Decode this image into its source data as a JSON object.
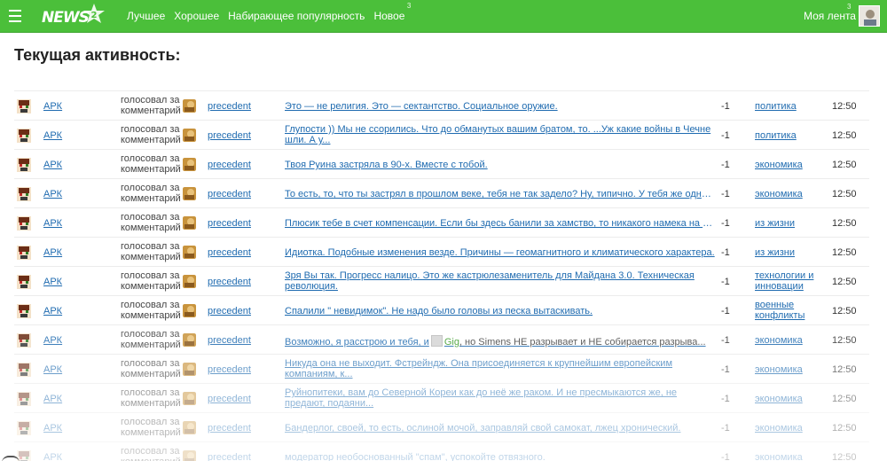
{
  "header": {
    "logo_text": "NEWS",
    "logo_badge": "2",
    "nav": [
      {
        "label": "Лучшее",
        "badge": ""
      },
      {
        "label": "Хорошее",
        "badge": ""
      },
      {
        "label": "Набирающее популярность",
        "badge": ""
      },
      {
        "label": "Новое",
        "badge": "3"
      }
    ],
    "my_feed": "Моя лента",
    "my_feed_count": "3"
  },
  "page_title": "Текущая активность:",
  "rows": [
    {
      "user": "АРК",
      "action": "голосовал за комментарий",
      "author": "precedent",
      "text": "Это — не религия.  Это — сектантство. Социальное оружие.",
      "score": "-1",
      "category": "политика",
      "time": "12:50"
    },
    {
      "user": "АРК",
      "action": "голосовал за комментарий",
      "author": "precedent",
      "text": "Глупости )) Мы не ссорились. Что до обманутых вашим братом,  то. ...Уж какие войны в Чечне шли. А у...",
      "score": "-1",
      "category": "политика",
      "time": "12:50"
    },
    {
      "user": "АРК",
      "action": "голосовал за комментарий",
      "author": "precedent",
      "text": "Твоя Руина застряла в 90-х.  Вместе с тобой.",
      "score": "-1",
      "category": "экономика",
      "time": "12:50"
    },
    {
      "user": "АРК",
      "action": "голосовал за комментарий",
      "author": "precedent",
      "text": "То есть,  то, что ты застрял в прошлом веке, тебя не так задело?  Ну,  типично. У тебя же одни ре...",
      "score": "-1",
      "category": "экономика",
      "time": "12:50"
    },
    {
      "user": "АРК",
      "action": "голосовал за комментарий",
      "author": "precedent",
      "text": "Плюсик тебе в счет компенсации.  Если бы здесь банили за хамство, то никакого намека на \" пр...",
      "score": "-1",
      "category": "из жизни",
      "time": "12:50"
    },
    {
      "user": "АРК",
      "action": "голосовал за комментарий",
      "author": "precedent",
      "text": "Идиотка.  Подобные изменения везде.  Причины — геомагнитного и климатического характера.",
      "score": "-1",
      "category": "из жизни",
      "time": "12:50"
    },
    {
      "user": "АРК",
      "action": "голосовал за комментарий",
      "author": "precedent",
      "text": "Зря Вы так.  Прогресс налицо. Это же кастрюлезаменитель для Майдана 3.0. Техническая революция.",
      "score": "-1",
      "category": "технологии и инновации",
      "time": "12:50"
    },
    {
      "user": "АРК",
      "action": "голосовал за комментарий",
      "author": "precedent",
      "text": "Спалили \" невидимок\". Не надо было головы из песка вытаскивать.",
      "score": "-1",
      "category": "военные конфликты",
      "time": "12:50"
    },
    {
      "user": "АРК",
      "action": "голосовал за комментарий",
      "author": "precedent",
      "text_before": "Возможно, я расстрою и тебя, и",
      "text_gig": "Gig",
      "text_after": ", но Simens НЕ разрывает и НЕ собирается разрыва...",
      "score": "-1",
      "category": "экономика",
      "time": "12:50"
    },
    {
      "user": "АРК",
      "action": "голосовал за комментарий",
      "author": "precedent",
      "text": "Никуда она не выходит. Фстрейндж. Она присоединяется к крупнейшим европейским компаниям, к...",
      "score": "-1",
      "category": "экономика",
      "time": "12:50"
    },
    {
      "user": "АРК",
      "action": "голосовал за комментарий",
      "author": "precedent",
      "text": "Руйнопитеки, вам до Северной Кореи как до неё же раком. И не пресмыкаются же, не предают, подаяни...",
      "score": "-1",
      "category": "экономика",
      "time": "12:50"
    },
    {
      "user": "АРК",
      "action": "голосовал за комментарий",
      "author": "precedent",
      "text": "Бандерлог, своей,  то есть,  ослиной мочой,  заправляй свой самокат, лжец хронический.",
      "score": "-1",
      "category": "экономика",
      "time": "12:50"
    },
    {
      "user": "АРК",
      "action": "голосовал за комментарий",
      "author": "precedent",
      "text": "модератор необоснованный \"спам\", успокойте отвязного.",
      "score": "-1",
      "category": "экономика",
      "time": "12:50"
    }
  ],
  "colors": {
    "accent": "#4bbf3a",
    "link": "#1f6bb0"
  }
}
